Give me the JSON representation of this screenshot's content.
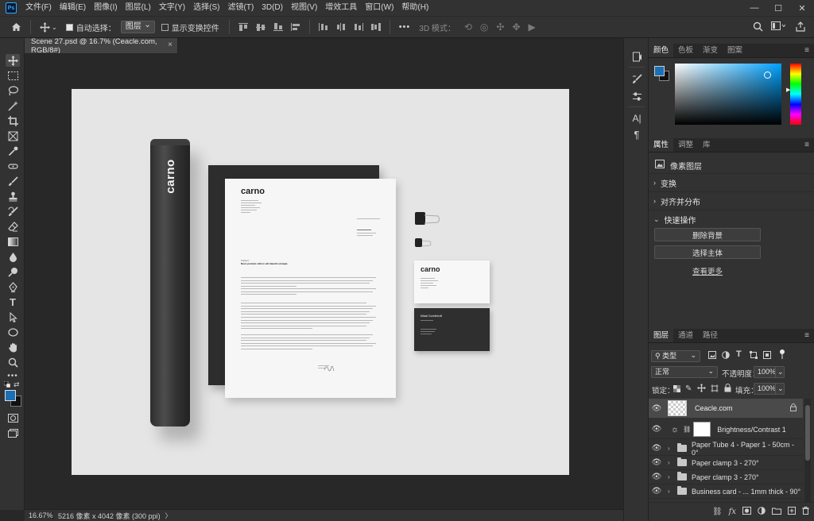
{
  "menubar": {
    "app_icon": "Ps",
    "items": [
      "文件(F)",
      "编辑(E)",
      "图像(I)",
      "图层(L)",
      "文字(Y)",
      "选择(S)",
      "滤镜(T)",
      "3D(D)",
      "视图(V)",
      "增效工具",
      "窗口(W)",
      "帮助(H)"
    ],
    "window_controls": [
      "—",
      "☐",
      "✕"
    ]
  },
  "options": {
    "auto_select_label": "自动选择：",
    "auto_select_target": "图层",
    "show_transform_label": "显示变换控件",
    "mode_3d_label": "3D 模式：",
    "more_label": "•••"
  },
  "document": {
    "tab_title": "Scene 27.psd @ 16.7% (Ceacle.com, RGB/8#)",
    "tab_close": "×"
  },
  "canvas": {
    "tube_text": "carno",
    "letter_logo": "carno",
    "letter_subject": "Subject:",
    "letter_heading": "Nunc pretium nibh in elit blandit volutpat.",
    "card_logo": "carno",
    "card_name": "Mikail Gorelishvili"
  },
  "status": {
    "zoom": "16.67%",
    "info": "5216 像素 x 4042 像素 (300 ppi)",
    "arrow": "〉"
  },
  "color_panel": {
    "tabs": [
      "颜色",
      "色板",
      "渐变",
      "图案"
    ],
    "foreground": "#1b6fb5",
    "background": "#ffffff",
    "hue": "#00a2ff"
  },
  "properties_panel": {
    "tabs": [
      "属性",
      "调整",
      "库"
    ],
    "type_label": "像素图层",
    "sections": [
      "变换",
      "对齐并分布",
      "快速操作"
    ],
    "buttons": [
      "删除背景",
      "选择主体"
    ],
    "more_link": "查看更多"
  },
  "layers_panel": {
    "tabs": [
      "图层",
      "通道",
      "路径"
    ],
    "filter_label": "类型",
    "blend_mode": "正常",
    "opacity_label": "不透明度：",
    "opacity_value": "100%",
    "lock_label": "锁定：",
    "fill_label": "填充：",
    "fill_value": "100%",
    "layers": [
      {
        "name": "Ceacle.com",
        "type": "pixel",
        "selected": true
      },
      {
        "name": "Brightness/Contrast 1",
        "type": "adjustment"
      },
      {
        "name": "Paper Tube 4 - Paper 1 - 50cm - 0°",
        "type": "group"
      },
      {
        "name": "Paper clamp 3 - 270°",
        "type": "group"
      },
      {
        "name": "Paper clamp 3 - 270°",
        "type": "group"
      },
      {
        "name": "Business card - ... 1mm thick - 90°",
        "type": "group"
      }
    ]
  }
}
